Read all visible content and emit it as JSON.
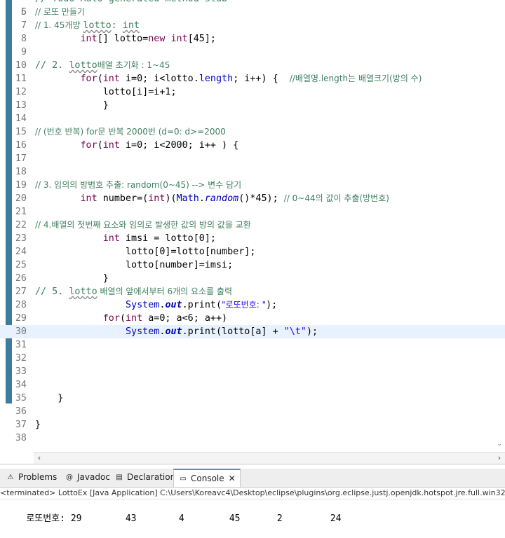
{
  "editor": {
    "top_partial": "// Todo Auto-generated method stub",
    "lines": [
      {
        "n": "6",
        "tokens": [
          {
            "t": "// 로또 만들기",
            "c": "t-cm t-ko"
          }
        ]
      },
      {
        "n": "7",
        "tokens": [
          {
            "t": "// 1. 45개방 ",
            "c": "t-cm"
          },
          {
            "t": "lotto",
            "c": "t-cm t-sq"
          },
          {
            "t": ": ",
            "c": "t-cm"
          },
          {
            "t": "int",
            "c": "t-cm t-sq"
          }
        ]
      },
      {
        "n": "8",
        "tokens": [
          {
            "t": "        "
          },
          {
            "t": "int",
            "c": "t-kw"
          },
          {
            "t": "[] lotto="
          },
          {
            "t": "new",
            "c": "t-kw"
          },
          {
            "t": " "
          },
          {
            "t": "int",
            "c": "t-kw"
          },
          {
            "t": "[45];"
          }
        ]
      },
      {
        "n": "9",
        "tokens": []
      },
      {
        "n": "10",
        "tokens": [
          {
            "t": "// 2. ",
            "c": "t-cm"
          },
          {
            "t": "lotto",
            "c": "t-cm t-sq"
          },
          {
            "t": "배열 초기화 : 1~45",
            "c": "t-cm"
          }
        ]
      },
      {
        "n": "11",
        "tokens": [
          {
            "t": "        "
          },
          {
            "t": "for",
            "c": "t-kw"
          },
          {
            "t": "("
          },
          {
            "t": "int",
            "c": "t-kw"
          },
          {
            "t": " i=0; i<lotto."
          },
          {
            "t": "length",
            "c": "t-fd"
          },
          {
            "t": "; i++) {  "
          },
          {
            "t": "//배열명.length는 배열크기(방의 수)",
            "c": "t-cm"
          }
        ]
      },
      {
        "n": "12",
        "tokens": [
          {
            "t": "            lotto[i]=i+1;"
          }
        ]
      },
      {
        "n": "13",
        "tokens": [
          {
            "t": "            }"
          }
        ]
      },
      {
        "n": "14",
        "tokens": []
      },
      {
        "n": "15",
        "tokens": [
          {
            "t": "// (번호 반복) for문 반복 2000번 (d=0: d>=2000",
            "c": "t-cm"
          }
        ]
      },
      {
        "n": "16",
        "tokens": [
          {
            "t": "        "
          },
          {
            "t": "for",
            "c": "t-kw"
          },
          {
            "t": "("
          },
          {
            "t": "int",
            "c": "t-kw"
          },
          {
            "t": " i=0; i<2000; i++ ) {"
          }
        ]
      },
      {
        "n": "17",
        "tokens": []
      },
      {
        "n": "18",
        "tokens": []
      },
      {
        "n": "19",
        "tokens": [
          {
            "t": "// 3. 임의의 방범호 추출: random(0~45) --> 변수 담기",
            "c": "t-cm"
          }
        ]
      },
      {
        "n": "20",
        "tokens": [
          {
            "t": "        "
          },
          {
            "t": "int",
            "c": "t-kw"
          },
          {
            "t": " number=("
          },
          {
            "t": "int",
            "c": "t-kw"
          },
          {
            "t": ")("
          },
          {
            "t": "Math",
            "c": "t-fd"
          },
          {
            "t": "."
          },
          {
            "t": "random",
            "c": "t-fd t-it"
          },
          {
            "t": "()*45); "
          },
          {
            "t": "// 0~44의 값이 추출(방번호)",
            "c": "t-cm"
          }
        ]
      },
      {
        "n": "21",
        "tokens": []
      },
      {
        "n": "22",
        "tokens": [
          {
            "t": "// 4.배열의 첫번째 요소와 임의로 발생한 값의 방의 값을 교환",
            "c": "t-cm"
          }
        ]
      },
      {
        "n": "23",
        "tokens": [
          {
            "t": "            "
          },
          {
            "t": "int",
            "c": "t-kw"
          },
          {
            "t": " imsi = lotto[0];"
          }
        ]
      },
      {
        "n": "24",
        "tokens": [
          {
            "t": "                lotto[0]=lotto[number];"
          }
        ]
      },
      {
        "n": "25",
        "tokens": [
          {
            "t": "                lotto[number]=imsi;"
          }
        ]
      },
      {
        "n": "26",
        "tokens": [
          {
            "t": "            }"
          }
        ]
      },
      {
        "n": "27",
        "tokens": [
          {
            "t": "// 5. ",
            "c": "t-cm"
          },
          {
            "t": "lotto",
            "c": "t-cm t-sq"
          },
          {
            "t": " 배열의 앞에서부터 6개의 요소를 출력",
            "c": "t-cm"
          }
        ]
      },
      {
        "n": "28",
        "tokens": [
          {
            "t": "                "
          },
          {
            "t": "System",
            "c": "t-fd"
          },
          {
            "t": "."
          },
          {
            "t": "out",
            "c": "t-sf"
          },
          {
            "t": ".print("
          },
          {
            "t": "\"로또번호: \"",
            "c": "t-st"
          },
          {
            "t": ");"
          }
        ]
      },
      {
        "n": "29",
        "tokens": [
          {
            "t": "            "
          },
          {
            "t": "for",
            "c": "t-kw"
          },
          {
            "t": "("
          },
          {
            "t": "int",
            "c": "t-kw"
          },
          {
            "t": " a=0; a<6; a++)"
          }
        ]
      },
      {
        "n": "30",
        "tokens": [
          {
            "t": "                "
          },
          {
            "t": "System",
            "c": "t-fd"
          },
          {
            "t": "."
          },
          {
            "t": "out",
            "c": "t-sf"
          },
          {
            "t": ".print(lotto[a] + "
          },
          {
            "t": "\"\\t\"",
            "c": "t-st"
          },
          {
            "t": ");"
          }
        ],
        "current": true
      },
      {
        "n": "31",
        "tokens": []
      },
      {
        "n": "32",
        "tokens": []
      },
      {
        "n": "33",
        "tokens": []
      },
      {
        "n": "34",
        "tokens": []
      },
      {
        "n": "35",
        "tokens": [
          {
            "t": "    }"
          }
        ]
      },
      {
        "n": "36",
        "tokens": []
      },
      {
        "n": "37",
        "tokens": [
          {
            "t": "}"
          }
        ]
      },
      {
        "n": "38",
        "tokens": []
      }
    ]
  },
  "tabs": [
    {
      "label": "Problems",
      "icon": "problems-icon",
      "glyph": "⚠"
    },
    {
      "label": "Javadoc",
      "icon": "javadoc-icon",
      "glyph": "@"
    },
    {
      "label": "Declaration",
      "icon": "declaration-icon",
      "glyph": "▤"
    },
    {
      "label": "Console",
      "icon": "console-icon",
      "glyph": "▭",
      "active": true,
      "close": "✕"
    }
  ],
  "console": {
    "status": "<terminated> LottoEx [Java Application] C:\\Users\\Koreavc4\\Desktop\\eclipse\\plugins\\org.eclipse.justj.openjdk.hotspot.jre.full.win32",
    "prefix": "로또번호: ",
    "numbers": [
      "29",
      "43",
      "4",
      "45",
      "2",
      "24"
    ]
  }
}
